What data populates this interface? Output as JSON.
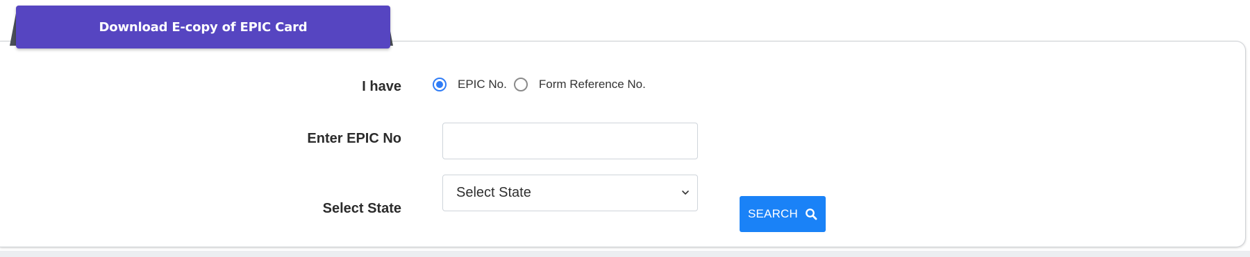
{
  "tab": {
    "title": "Download E-copy of EPIC Card"
  },
  "form": {
    "i_have_label": "I have",
    "options": [
      {
        "label": "EPIC No.",
        "selected": true
      },
      {
        "label": "Form Reference No.",
        "selected": false
      }
    ],
    "epic_label": "Enter EPIC No",
    "epic_value": "",
    "epic_placeholder": "",
    "state_label": "Select State",
    "state_selected": "Select State",
    "search_button": "SEARCH",
    "search_icon": "search-icon"
  },
  "colors": {
    "tab_bg": "#5645c1",
    "radio_accent": "#2f7cf6",
    "button_bg": "#1a82f7"
  }
}
